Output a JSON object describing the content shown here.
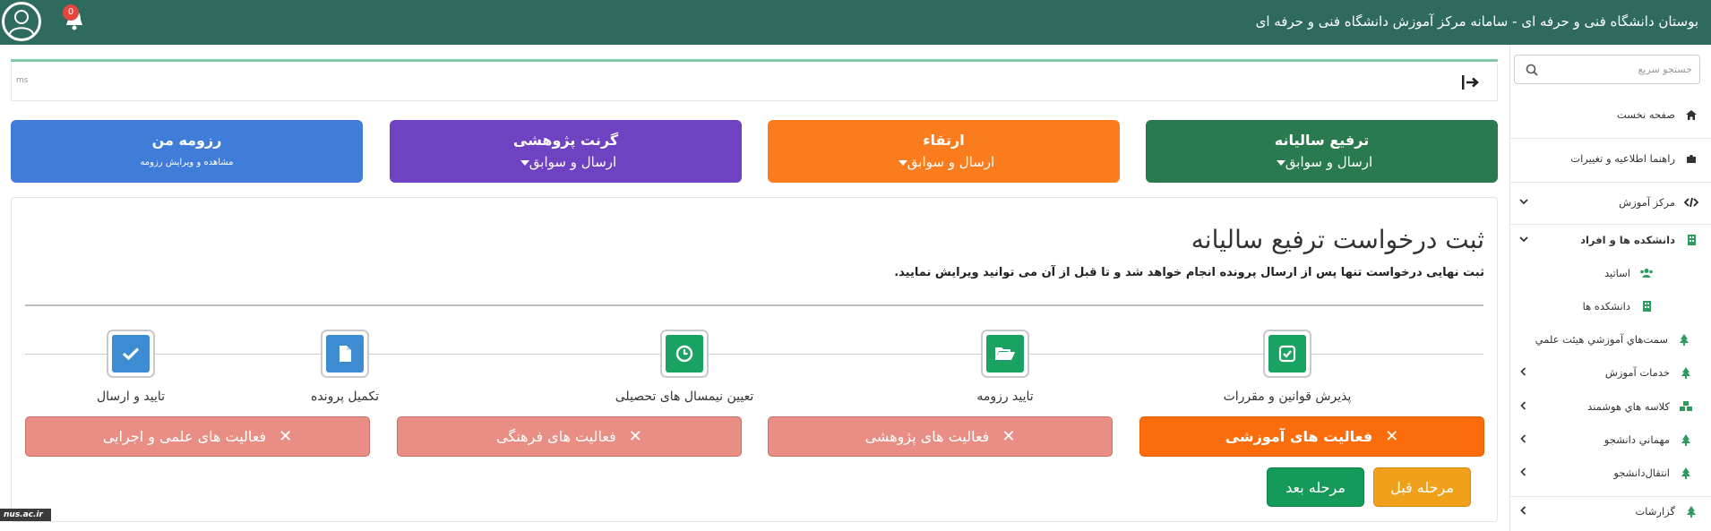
{
  "header": {
    "title": "بوستان دانشگاه فنی و حرفه ای - سامانه مرکز آموزش دانشگاه فنی و حرفه ای",
    "notification_count": "0",
    "bg_color": "#2e6b5e"
  },
  "sidebar": {
    "search_placeholder": "جستجو سریع",
    "items": [
      {
        "label": "صفحه نخست",
        "icon": "home-icon"
      },
      {
        "label": "راهنما اطلاعیه و تغییرات",
        "icon": "puzzle-icon"
      },
      {
        "label": "مرکز آموزش",
        "icon": "code-icon"
      },
      {
        "label": "دانشکده ها و افراد",
        "icon": "building-icon"
      },
      {
        "label": "اساتید",
        "icon": "users-icon"
      },
      {
        "label": "دانشکده ها",
        "icon": "building-icon"
      },
      {
        "label": "سمت‌هاي آموزشي هيئت علمي",
        "icon": "tree-icon"
      },
      {
        "label": "خدمات آموزش",
        "icon": "tree-icon"
      },
      {
        "label": "كلاسه هاي هوشمند",
        "icon": "cubes-icon"
      },
      {
        "label": "مهماني دانشجو",
        "icon": "tree-icon"
      },
      {
        "label": "انتقال‌دانشجو",
        "icon": "tree-icon"
      },
      {
        "label": "گزارشات",
        "icon": "tree-icon"
      }
    ]
  },
  "toolbar": {
    "timer_text": "ms"
  },
  "cards": [
    {
      "title": "ترفیع سالیانه",
      "sub": "ارسال و سوابق",
      "color": "#2a7a4f"
    },
    {
      "title": "ارتقاء",
      "sub": "ارسال و سوابق",
      "color": "#fb7c1c"
    },
    {
      "title": "گرنت پژوهشی",
      "sub": "ارسال و سوابق",
      "color": "#6f42c1"
    },
    {
      "title": "رزومه من",
      "sub": "مشاهده و ویرایش رزومه",
      "color": "#3f7dd8"
    }
  ],
  "panel": {
    "title": "ثبت درخواست ترفیع سالیانه",
    "note": "ثبت نهایی درخواست تنها پس از ارسال پرونده انجام خواهد شد و تا قبل از آن می توانید ویرایش نمایید."
  },
  "steps": [
    {
      "label": "پذیرش قوانین و مقررات",
      "icon": "check-square-icon",
      "color": "#1aa263"
    },
    {
      "label": "تایید رزومه",
      "icon": "folder-open-icon",
      "color": "#1aa263"
    },
    {
      "label": "تعیین نیمسال های تحصیلی",
      "icon": "clock-icon",
      "color": "#1aa263"
    },
    {
      "label": "تکمیل پرونده",
      "icon": "file-icon",
      "color": "#3d8bd0"
    },
    {
      "label": "تایید و ارسال",
      "icon": "check-icon",
      "color": "#3d8bd0"
    }
  ],
  "activities": [
    {
      "label": "فعالیت های آموزشی",
      "active": true
    },
    {
      "label": "فعالیت های پژوهشی",
      "active": false
    },
    {
      "label": "فعالیت های فرهنگی",
      "active": false
    },
    {
      "label": "فعالیت های علمی و اجرایی",
      "active": false
    }
  ],
  "nav": {
    "prev_label": "مرحله قبل",
    "next_label": "مرحله بعد",
    "prev_color": "#f0a11c",
    "next_color": "#159a5b"
  },
  "footer_badge": "nus.ac.ir"
}
